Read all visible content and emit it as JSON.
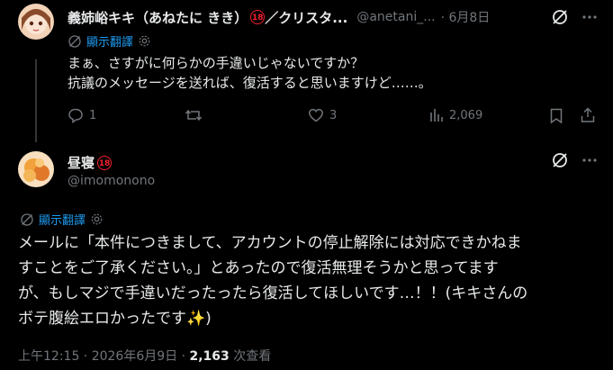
{
  "reply": {
    "display_name": "義姉峪キキ（あねたに きき）",
    "badge": "18",
    "name_suffix": "／クリスタ...",
    "handle": "@anetani_...",
    "date": "· 6月8日",
    "translate_label": "顯示翻譯",
    "text_lines": [
      "まぁ、さすがに何らかの手違いじゃないですか？",
      "抗議のメッセージを送れば、復活すると思いますけど……。"
    ],
    "replies": "1",
    "reposts": "",
    "likes": "3",
    "views": "2,069"
  },
  "main": {
    "display_name": "昼寝",
    "badge": "18",
    "handle": "@imomonono",
    "translate_label": "顯示翻譯",
    "text_lines": [
      "メールに「本件につきまして、アカウントの停止解除には対応できかねま",
      "すことをご了承ください。」とあったので復活無理そうかと思ってます",
      "が、もしマジで手違いだったったら復活してほしいです…！！(キキさんの",
      "ボテ腹絵エロかったです✨)"
    ],
    "timestamp": "上午12:15 · 2026年6月9日 · ",
    "view_count": "2,163",
    "view_label": " 次查看"
  },
  "colors": {
    "background": "#000000",
    "text": "#e7e9ea",
    "muted": "#71767b",
    "link": "#1d9bf0",
    "badge": "#f4212e"
  }
}
